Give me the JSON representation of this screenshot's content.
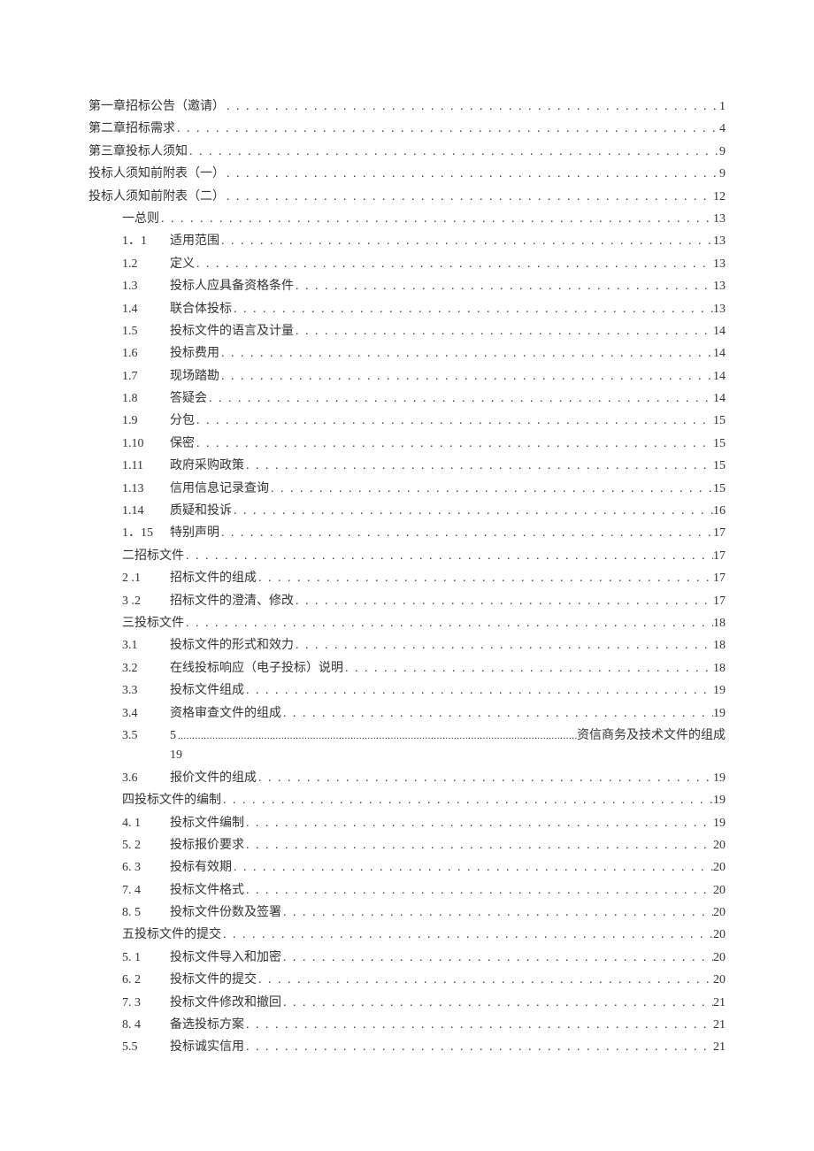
{
  "toc": [
    {
      "num": "",
      "label": "第一章招标公告（邀请）",
      "page": "1",
      "indent": 0
    },
    {
      "num": "",
      "label": "第二章招标需求",
      "page": "4",
      "indent": 0
    },
    {
      "num": "",
      "label": "第三章投标人须知",
      "page": "9",
      "indent": 0
    },
    {
      "num": "",
      "label": "投标人须知前附表（一）",
      "page": "9",
      "indent": 0
    },
    {
      "num": "",
      "label": "投标人须知前附表（二）",
      "page": "12",
      "indent": 0
    },
    {
      "num": "一",
      "label": "总则",
      "page": "13",
      "indent": 1
    },
    {
      "num": "1．1",
      "label": "适用范围",
      "page": "13",
      "indent": 2
    },
    {
      "num": "1.2",
      "label": "定义",
      "page": "13",
      "indent": 2
    },
    {
      "num": "1.3",
      "label": "投标人应具备资格条件",
      "page": "13",
      "indent": 2
    },
    {
      "num": "1.4",
      "label": "联合体投标",
      "page": "13",
      "indent": 2
    },
    {
      "num": "1.5",
      "label": "投标文件的语言及计量",
      "page": "14",
      "indent": 2
    },
    {
      "num": "1.6",
      "label": "投标费用",
      "page": "14",
      "indent": 2
    },
    {
      "num": "1.7",
      "label": "现场踏勘",
      "page": "14",
      "indent": 2
    },
    {
      "num": "1.8",
      "label": "答疑会",
      "page": "14",
      "indent": 2
    },
    {
      "num": "1.9",
      "label": "分包",
      "page": "15",
      "indent": 2
    },
    {
      "num": "1.10",
      "label": "保密",
      "page": "15",
      "indent": 2
    },
    {
      "num": "1.11",
      "label": "政府采购政策",
      "page": "15",
      "indent": 2
    },
    {
      "num": "1.13",
      "label": "信用信息记录查询",
      "page": "15",
      "indent": 2
    },
    {
      "num": "1.14",
      "label": "质疑和投诉",
      "page": "16",
      "indent": 2
    },
    {
      "num": "1．15",
      "label": "特别声明",
      "page": "17",
      "indent": 2
    },
    {
      "num": "二",
      "label": "招标文件",
      "page": "17",
      "indent": 1
    },
    {
      "num": "2  .1",
      "label": "招标文件的组成",
      "page": "17",
      "indent": 2
    },
    {
      "num": "3   .2",
      "label": "招标文件的澄清、修改",
      "page": "17",
      "indent": 2
    },
    {
      "num": "三",
      "label": "投标文件",
      "page": "18",
      "indent": 1
    },
    {
      "num": "3.1",
      "label": "投标文件的形式和效力",
      "page": "18",
      "indent": 2
    },
    {
      "num": "3.2",
      "label": "在线投标响应（电子投标）说明",
      "page": "18",
      "indent": 2
    },
    {
      "num": "3.3",
      "label": "投标文件组成",
      "page": "19",
      "indent": 2
    },
    {
      "num": "3.4",
      "label": "资格审查文件的组成",
      "page": "19",
      "indent": 2
    },
    {
      "num": "3.5",
      "numLeader": "5",
      "trail": "资信商务及技术文件的组成",
      "page2": "19",
      "indent": 2,
      "special": true
    },
    {
      "num": "3.6",
      "label": "报价文件的组成",
      "page": "19",
      "indent": 2
    },
    {
      "num": "四",
      "label": "投标文件的编制",
      "page": "19",
      "indent": 1
    },
    {
      "num": "4.  1",
      "label": "投标文件编制",
      "page": "19",
      "indent": 2
    },
    {
      "num": "5.  2",
      "label": "投标报价要求",
      "page": "20",
      "indent": 2
    },
    {
      "num": "6.  3",
      "label": "投标有效期",
      "page": "20",
      "indent": 2
    },
    {
      "num": "7.  4",
      "label": "投标文件格式",
      "page": "20",
      "indent": 2
    },
    {
      "num": "8.  5",
      "label": "投标文件份数及签署",
      "page": "20",
      "indent": 2
    },
    {
      "num": "五",
      "label": "投标文件的提交",
      "page": "20",
      "indent": 1
    },
    {
      "num": "5.  1",
      "label": "投标文件导入和加密",
      "page": "20",
      "indent": 2
    },
    {
      "num": "6.  2",
      "label": "投标文件的提交",
      "page": "20",
      "indent": 2
    },
    {
      "num": "7.  3",
      "label": "投标文件修改和撤回",
      "page": "21",
      "indent": 2
    },
    {
      "num": "8.  4",
      "label": "备选投标方案",
      "page": "21",
      "indent": 2
    },
    {
      "num": "5.5",
      "label": "投标诚实信用",
      "page": "21",
      "indent": 2
    }
  ]
}
